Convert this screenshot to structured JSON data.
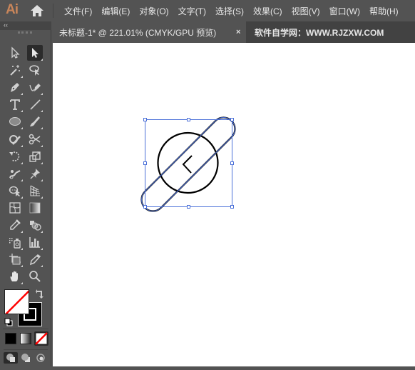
{
  "app": {
    "logo": "Ai",
    "home_icon": "home-icon"
  },
  "menu": [
    {
      "label": "文件(F)"
    },
    {
      "label": "编辑(E)"
    },
    {
      "label": "对象(O)"
    },
    {
      "label": "文字(T)"
    },
    {
      "label": "选择(S)"
    },
    {
      "label": "效果(C)"
    },
    {
      "label": "视图(V)"
    },
    {
      "label": "窗口(W)"
    },
    {
      "label": "帮助(H)"
    }
  ],
  "panel": {
    "collapse_label": "‹‹"
  },
  "document_tab": {
    "title": "未标题-1* @ 221.01% (CMYK/GPU 预览)",
    "close_label": "×"
  },
  "site_tab": {
    "label": "软件自学网：WWW.RJZXW.COM"
  },
  "tools": [
    {
      "name": "direct-selection-tool",
      "icon": "hollow-arrow-icon"
    },
    {
      "name": "selection-tool",
      "icon": "solid-arrow-icon",
      "active": true
    },
    {
      "name": "magic-wand-tool",
      "icon": "magic-wand-icon"
    },
    {
      "name": "lasso-tool",
      "icon": "lasso-icon"
    },
    {
      "name": "pen-tool",
      "icon": "pen-icon"
    },
    {
      "name": "curvature-tool",
      "icon": "curvature-pen-icon"
    },
    {
      "name": "type-tool",
      "icon": "type-icon"
    },
    {
      "name": "line-tool",
      "icon": "line-icon"
    },
    {
      "name": "ellipse-tool",
      "icon": "ellipse-icon"
    },
    {
      "name": "paintbrush-tool",
      "icon": "brush-icon"
    },
    {
      "name": "shaper-tool",
      "icon": "shaper-icon"
    },
    {
      "name": "scissors-tool",
      "icon": "scissors-icon"
    },
    {
      "name": "rotate-tool",
      "icon": "rotate-icon"
    },
    {
      "name": "scale-tool",
      "icon": "scale-icon"
    },
    {
      "name": "warp-tool",
      "icon": "warp-icon"
    },
    {
      "name": "puppet-warp-tool",
      "icon": "pin-icon"
    },
    {
      "name": "shape-builder-tool",
      "icon": "shape-builder-icon"
    },
    {
      "name": "perspective-grid-tool",
      "icon": "perspective-grid-icon"
    },
    {
      "name": "mesh-tool",
      "icon": "mesh-icon"
    },
    {
      "name": "gradient-tool",
      "icon": "gradient-icon"
    },
    {
      "name": "eyedropper-tool",
      "icon": "eyedropper-icon"
    },
    {
      "name": "blend-tool",
      "icon": "blend-icon"
    },
    {
      "name": "symbol-sprayer-tool",
      "icon": "symbol-sprayer-icon"
    },
    {
      "name": "column-graph-tool",
      "icon": "bar-graph-icon"
    },
    {
      "name": "artboard-tool",
      "icon": "artboard-icon"
    },
    {
      "name": "slice-tool",
      "icon": "slice-knife-icon"
    },
    {
      "name": "hand-tool",
      "icon": "hand-icon"
    },
    {
      "name": "zoom-tool",
      "icon": "magnifier-icon"
    }
  ],
  "colors": {
    "fill": "none",
    "stroke": "#000000",
    "selection_color": "#4a6fd8",
    "none_slash": "#ff0000"
  }
}
